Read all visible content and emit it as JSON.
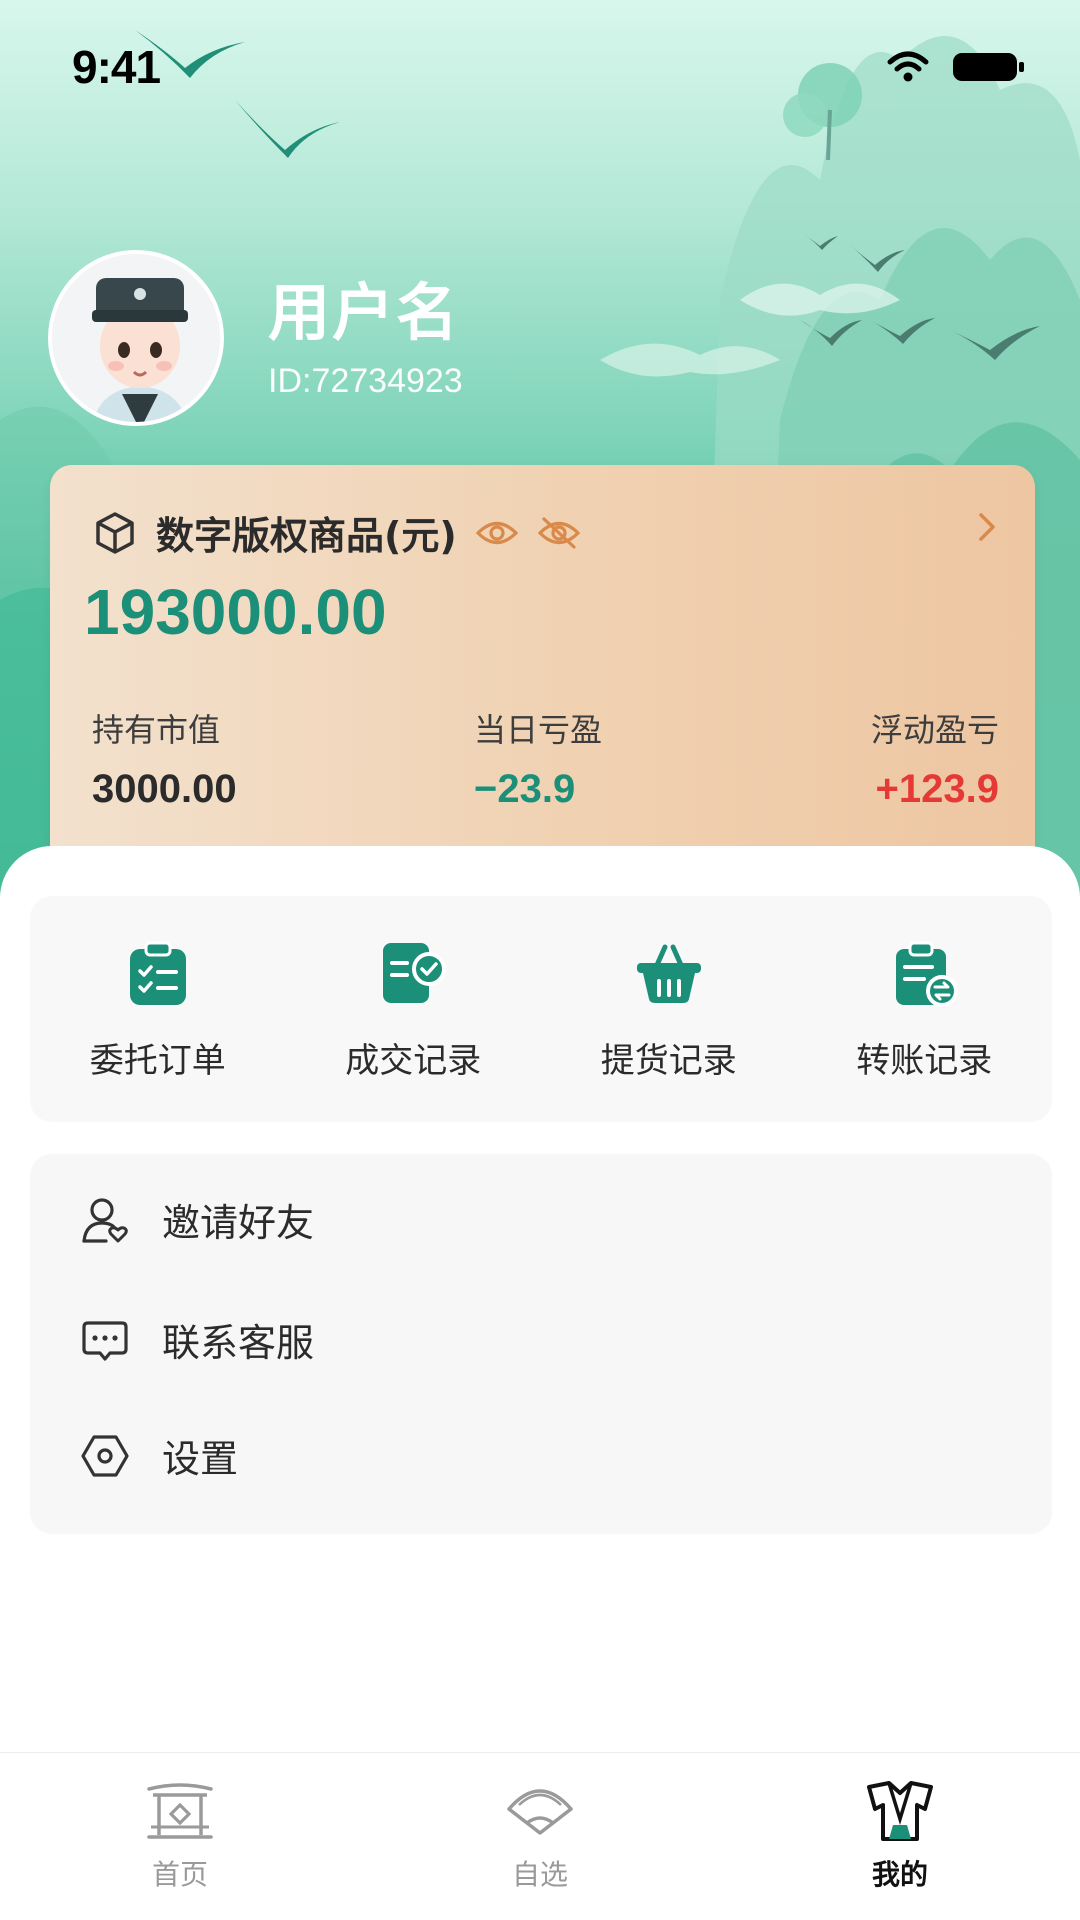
{
  "status_bar": {
    "time": "9:41"
  },
  "profile": {
    "username": "用户名",
    "user_id": "ID:72734923"
  },
  "asset_card": {
    "title": "数字版权商品(元)",
    "total": "193000.00",
    "stats": [
      {
        "label": "持有市值",
        "value": "3000.00",
        "trend": "neutral"
      },
      {
        "label": "当日亏盈",
        "value": "−23.9",
        "trend": "down"
      },
      {
        "label": "浮动盈亏",
        "value": "+123.9",
        "trend": "up"
      }
    ]
  },
  "quick_actions": [
    {
      "label": "委托订单",
      "icon": "clipboard-check-icon"
    },
    {
      "label": "成交记录",
      "icon": "document-check-icon"
    },
    {
      "label": "提货记录",
      "icon": "basket-icon"
    },
    {
      "label": "转账记录",
      "icon": "clipboard-transfer-icon"
    }
  ],
  "menu": [
    {
      "label": "邀请好友",
      "icon": "user-heart-icon"
    },
    {
      "label": "联系客服",
      "icon": "chat-bubble-icon"
    },
    {
      "label": "设置",
      "icon": "hexagon-settings-icon"
    }
  ],
  "tabs": [
    {
      "label": "首页",
      "icon": "pavilion-icon",
      "active": false
    },
    {
      "label": "自选",
      "icon": "fan-icon",
      "active": false
    },
    {
      "label": "我的",
      "icon": "robe-icon",
      "active": true
    }
  ],
  "colors": {
    "brand_green": "#1b8f78",
    "up_red": "#e53935",
    "card_gradient_start": "#f3e1cd",
    "card_gradient_end": "#eec6a2"
  }
}
